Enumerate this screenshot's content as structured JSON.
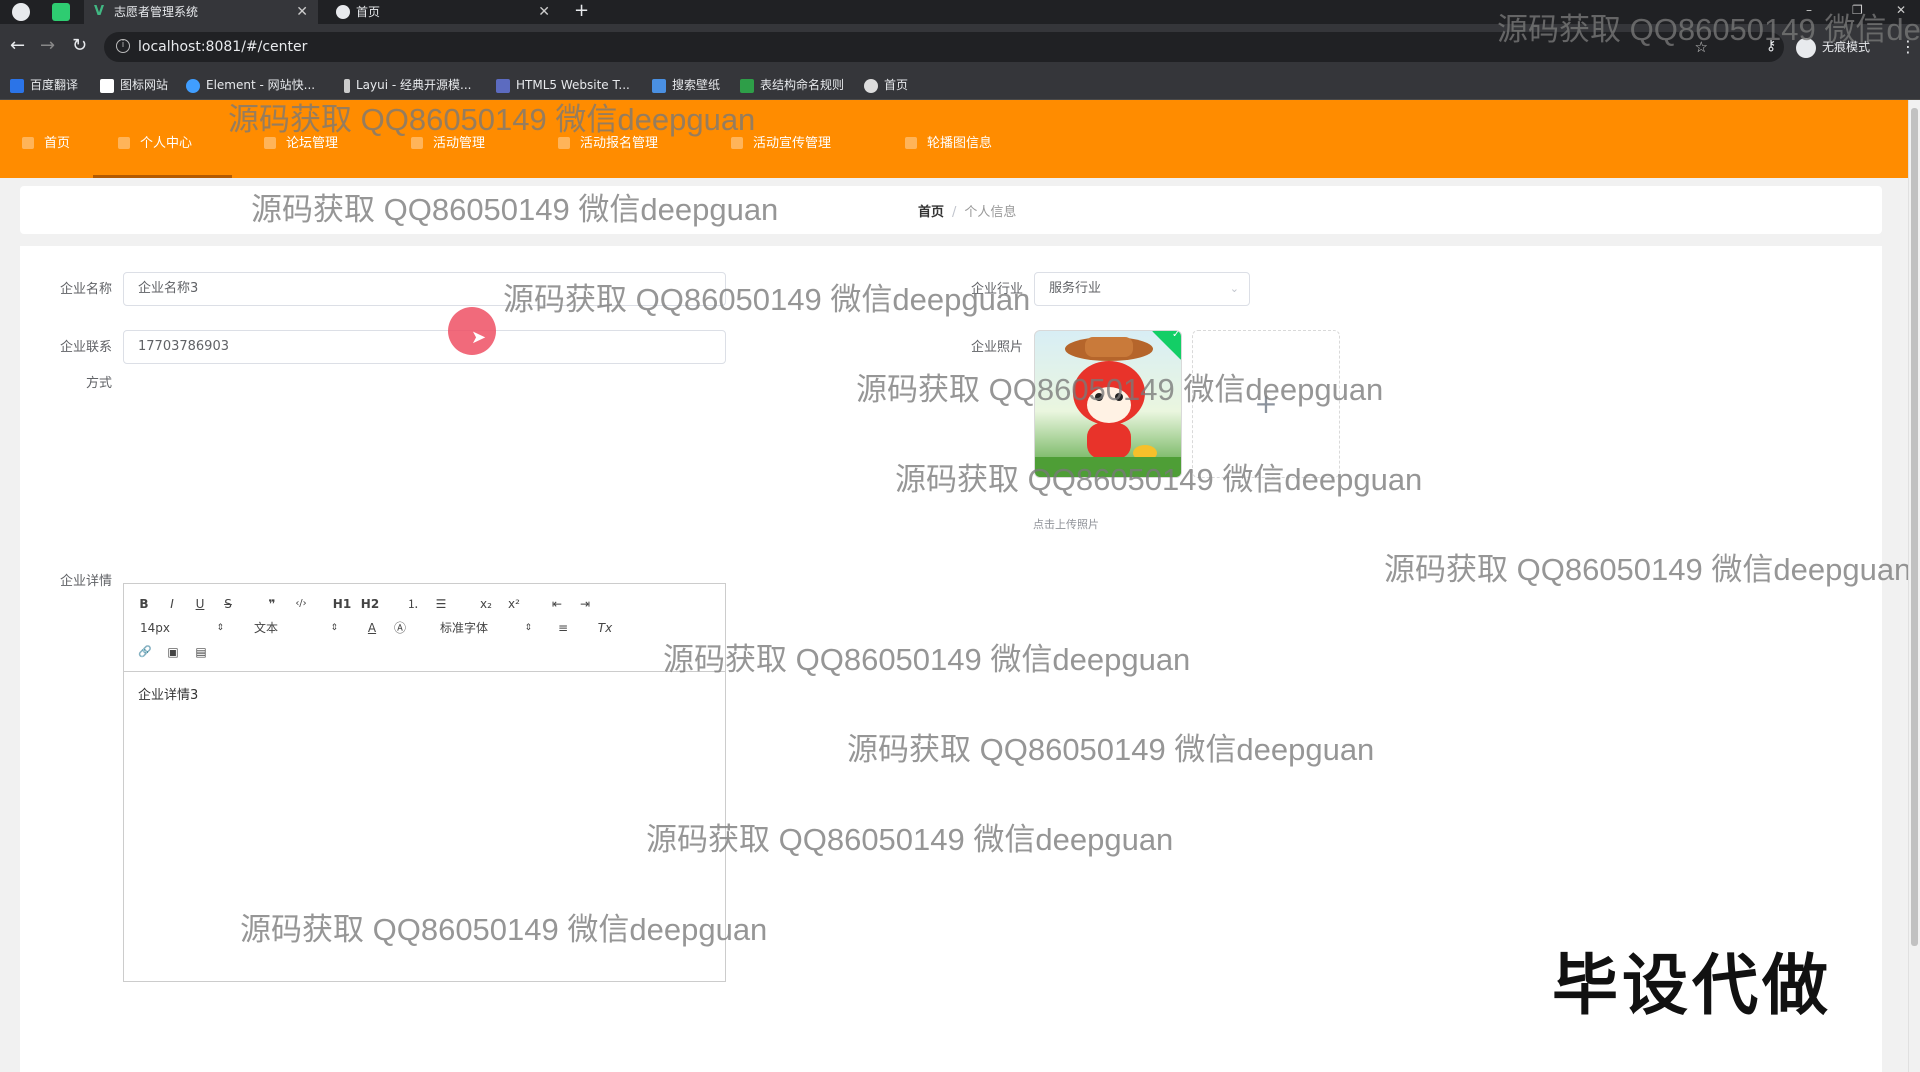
{
  "browser": {
    "tabs": [
      {
        "title": "志愿者管理系统",
        "active": true
      },
      {
        "title": "首页",
        "active": false
      }
    ],
    "new_tab": "+",
    "url": "localhost:8081/#/center",
    "incognito_label": "无痕模式",
    "bookmarks": [
      {
        "label": "百度翻译",
        "color": "#2b74e8"
      },
      {
        "label": "图标网站",
        "color": "#ffffff"
      },
      {
        "label": "Element - 网站快...",
        "color": "#409eff"
      },
      {
        "label": "Layui - 经典开源模...",
        "color": "#cccccc"
      },
      {
        "label": "HTML5 Website T...",
        "color": "#5c6bc0"
      },
      {
        "label": "搜索壁纸",
        "color": "#4a90e2"
      },
      {
        "label": "表结构命名规则",
        "color": "#2e9e48"
      },
      {
        "label": "首页",
        "color": "#dddddd"
      }
    ]
  },
  "nav": {
    "items": [
      {
        "label": "首页",
        "active": false
      },
      {
        "label": "个人中心",
        "active": true
      },
      {
        "label": "论坛管理",
        "active": false
      },
      {
        "label": "活动管理",
        "active": false
      },
      {
        "label": "活动报名管理",
        "active": false
      },
      {
        "label": "活动宣传管理",
        "active": false
      },
      {
        "label": "轮播图信息",
        "active": false
      }
    ],
    "color": "#ff8c00"
  },
  "breadcrumb": {
    "home": "首页",
    "separator": "/",
    "current": "个人信息"
  },
  "form": {
    "name_label": "企业名称",
    "name_value": "企业名称3",
    "industry_label": "企业行业",
    "industry_value": "服务行业",
    "contact_label_1": "企业联系",
    "contact_label_2": "方式",
    "contact_value": "17703786903",
    "photo_label": "企业照片",
    "upload_tip": "点击上传照片",
    "upload_plus": "+",
    "detail_label": "企业详情"
  },
  "editor": {
    "font_size": "14px",
    "header_select": "文本",
    "font_family": "标准字体",
    "content": "企业详情3",
    "buttons": {
      "bold": "B",
      "italic": "I",
      "underline": "U",
      "strike": "S",
      "quote": "❞",
      "code": "‹/›",
      "h1": "H1",
      "h2": "H2",
      "ordered": "⒈",
      "bullet": "☰",
      "sub": "x₂",
      "sup": "x²",
      "outdent": "⇤",
      "indent": "⇥",
      "color": "A",
      "background": "Ⓐ",
      "align": "≡",
      "clean": "Tx",
      "link": "🔗",
      "image": "▣",
      "video": "▤"
    }
  },
  "watermark": "源码获取 QQ86050149 微信deepguan",
  "stamp": "毕设代做"
}
